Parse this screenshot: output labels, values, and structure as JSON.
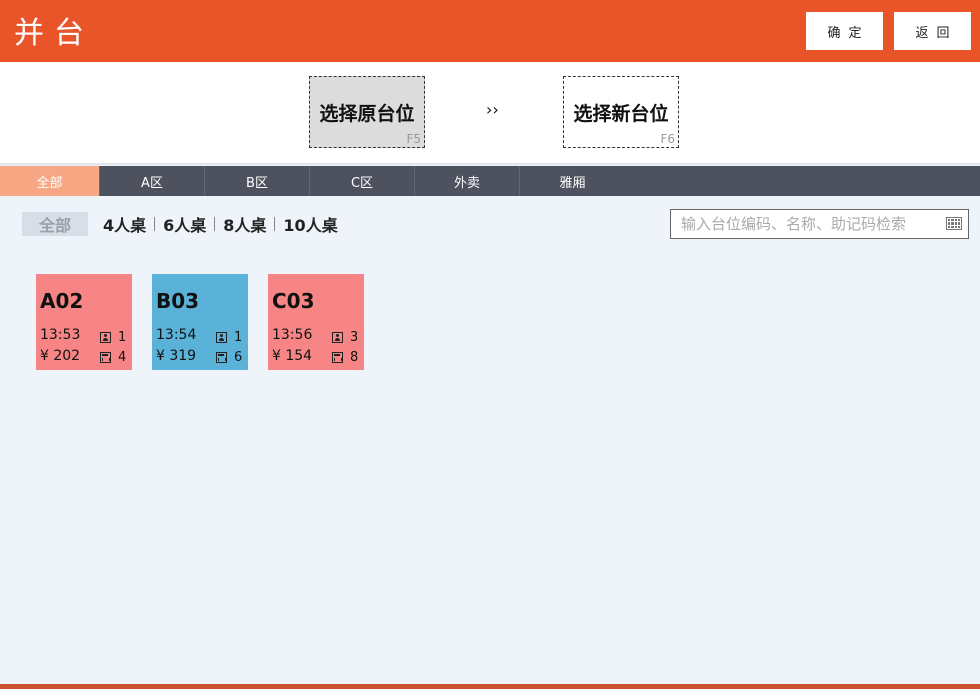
{
  "header": {
    "title": "并台",
    "confirm_label": "确定",
    "back_label": "返回"
  },
  "selection": {
    "original": {
      "label": "选择原台位",
      "key": "F5"
    },
    "arrow": "››",
    "new": {
      "label": "选择新台位",
      "key": "F6"
    }
  },
  "tabs": [
    {
      "label": "全部",
      "active": true
    },
    {
      "label": "A区"
    },
    {
      "label": "B区"
    },
    {
      "label": "C区"
    },
    {
      "label": "外卖"
    },
    {
      "label": "雅厢"
    }
  ],
  "filters": [
    {
      "label": "全部",
      "active": true
    },
    {
      "label": "4人桌"
    },
    {
      "label": "6人桌"
    },
    {
      "label": "8人桌"
    },
    {
      "label": "10人桌"
    }
  ],
  "search": {
    "placeholder": "输入台位编码、名称、助记码检索"
  },
  "tables": [
    {
      "code": "A02",
      "time": "13:53",
      "amount": "¥ 202",
      "persons": "1",
      "seats": "4",
      "color": "#f78585"
    },
    {
      "code": "B03",
      "time": "13:54",
      "amount": "¥ 319",
      "persons": "1",
      "seats": "6",
      "color": "#5ab2d8"
    },
    {
      "code": "C03",
      "time": "13:56",
      "amount": "¥ 154",
      "persons": "3",
      "seats": "8",
      "color": "#f78585"
    }
  ],
  "colors": {
    "brand": "#e95528",
    "tab_bar": "#4d525e",
    "tab_active": "#f7a784",
    "background": "#eff3fa"
  }
}
